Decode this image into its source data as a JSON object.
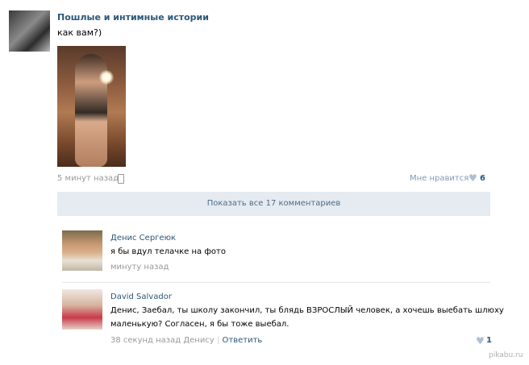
{
  "post": {
    "author": "Пошлые и интимные истории",
    "text": "как вам?)",
    "time": "5 минут назад",
    "like_label": "Мне нравится",
    "like_count": "6"
  },
  "comments_bar": {
    "show_all_label": "Показать все 17 комментариев"
  },
  "comments": [
    {
      "author": "Денис Сергеюк",
      "text": "я бы вдул телачке на фото",
      "time": "минуту назад"
    },
    {
      "author": "David Salvador",
      "text_line1": "Денис, Заебал, ты школу закончил, ты блядь ВЗРОСЛЫЙ человек, а хочешь выебать шлюху",
      "text_line2": "маленькую? Согласен, я бы тоже выебал.",
      "time": "38 секунд назад Денису",
      "reply_label": "Ответить",
      "like_count": "1"
    }
  ],
  "watermark": "pikabu.ru",
  "colors": {
    "link": "#2b587a",
    "muted": "#999999",
    "bar_bg": "#e5ebf1",
    "heart": "#aebfd1"
  }
}
